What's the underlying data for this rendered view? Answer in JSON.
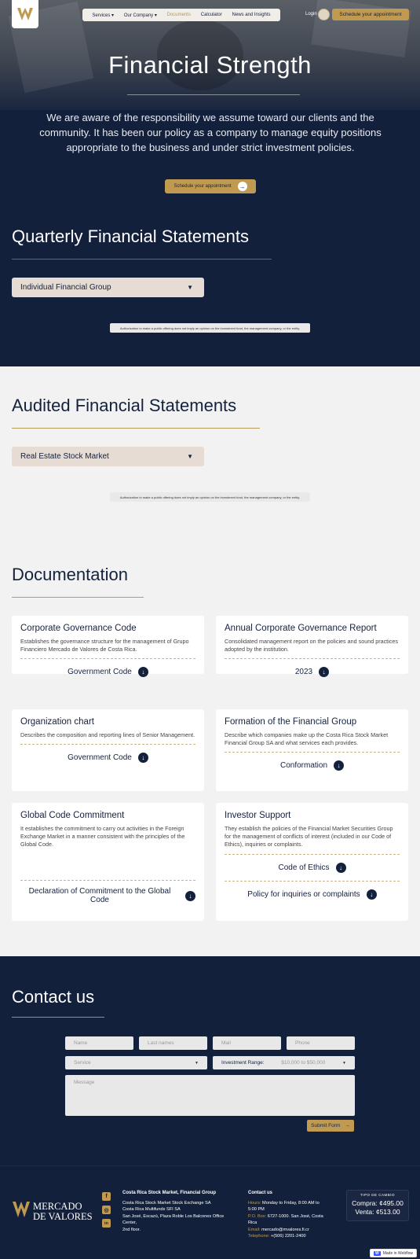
{
  "colors": {
    "navy": "#13203b",
    "gold": "#c19a52",
    "light": "#f2f2f2",
    "dropdown": "#e6dcd3"
  },
  "header": {
    "nav": [
      "Services ▾",
      "Our Company ▾",
      "Documents",
      "Calculator",
      "News and Insights"
    ],
    "login": "Login",
    "cta": "Schedule your appointment"
  },
  "hero": {
    "title": "Financial Strength",
    "text": "We are aware of the responsibility we assume toward our clients and the community. It has been our policy as a company to manage equity positions appropriate to the business and under strict investment policies.",
    "cta": "Schedule your appointment"
  },
  "quarterly": {
    "title": "Quarterly Financial Statements",
    "select": "Individual Financial Group",
    "note": "Authorization to make a public offering does not imply an opinion on the investment fund, the management company, or the entity."
  },
  "audited": {
    "title": "Audited Financial Statements",
    "select": "Real Estate Stock Market",
    "note": "Authorization to make a public offering does not imply an opinion on the investment fund, the management company, or the entity."
  },
  "documentation": {
    "title": "Documentation",
    "cards": [
      {
        "title": "Corporate Governance Code",
        "desc": "Establishes the governance structure for the management of Grupo Financiero Mercado de Valores de Costa Rica.",
        "links": [
          "Government Code"
        ]
      },
      {
        "title": "Annual Corporate Governance Report",
        "desc": "Consolidated management report on the policies and sound practices adopted by the institution.",
        "links": [
          "2023"
        ]
      },
      {
        "title": "Organization chart",
        "desc": "Describes the composition and reporting lines of Senior Management.",
        "links": [
          "Government Code"
        ]
      },
      {
        "title": "Formation of the Financial Group",
        "desc": "Describe which companies make up the Costa Rica Stock Market Financial Group SA and what services each provides.",
        "links": [
          "Conformation"
        ]
      },
      {
        "title": "Global Code Commitment",
        "desc": "It establishes the commitment to carry out activities in the Foreign Exchange Market in a manner consistent with the principles of the Global Code.",
        "links": [
          "Declaration of Commitment to the Global Code"
        ]
      },
      {
        "title": "Investor Support",
        "desc": "They establish the policies of the Financial Market Securities Group for the management of conflicts of interest (included in our Code of Ethics), inquiries or complaints.",
        "links": [
          "Code of Ethics",
          "Policy for inquiries or complaints"
        ]
      }
    ]
  },
  "contact": {
    "title": "Contact us",
    "placeholders": {
      "name": "Name",
      "last": "Last names",
      "mail": "Mail",
      "phone": "Phone",
      "service": "Service",
      "message": "Message"
    },
    "range_label": "Investment Range:",
    "range_value": "$10,000 to $50,000",
    "submit": "Submit Form"
  },
  "footer": {
    "logo_line1": "MERCADO",
    "logo_line2": "DE VALORES",
    "col1_title": "Costa Rica Stock Market, Financial Group",
    "col1_lines": [
      "Costa Rica Stock Market Stock Exchange SA",
      "Costa Rica Multifunds SFI SA",
      "San José, Escazú, Plaza Roble Los Balcones Office Center,",
      "2nd floor."
    ],
    "col2_title": "Contact us",
    "hours_label": "Hours:",
    "hours": "Monday to Friday, 8:00 AM to 5:00 PM",
    "po_label": "P.O. Box:",
    "po": "6727-1000. San José, Costa Rica",
    "email_label": "Email:",
    "email": "mercado@mvalores.fi.cr",
    "tel_label": "Telephone:",
    "tel": "+(506) 2201-2400",
    "rate_title": "TIPO DE CAMBIO",
    "buy": "Compra: ¢495.00",
    "sell": "Venta: ¢513.00",
    "social": [
      "f",
      "◎",
      "in"
    ]
  },
  "badge": "Made in Webflow"
}
